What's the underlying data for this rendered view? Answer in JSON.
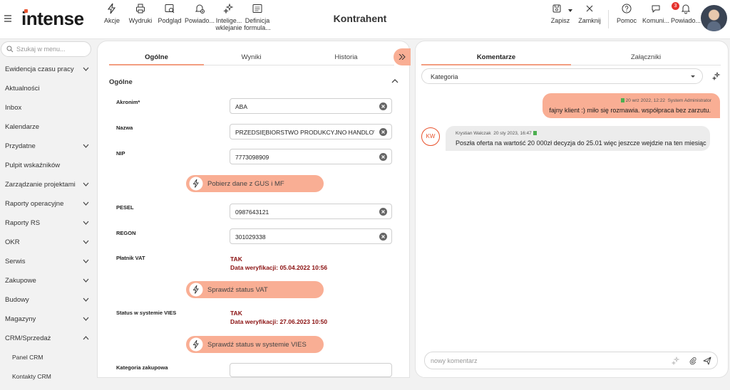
{
  "app": {
    "logo": "intense",
    "page_title": "Kontrahent"
  },
  "colors": {
    "accent": "#e8522d",
    "button": "#f9ae94",
    "vat_text": "#8a1010",
    "badge": "#e5322d"
  },
  "toolbar": {
    "left": [
      {
        "icon": "lightning-icon",
        "label": "Akcje"
      },
      {
        "icon": "printer-icon",
        "label": "Wydruki"
      },
      {
        "icon": "preview-icon",
        "label": "Podgląd"
      },
      {
        "icon": "notification-add-icon",
        "label": "Powiado..."
      },
      {
        "icon": "sparkle-icon",
        "label": "Intelige...",
        "label2": "wklejanie"
      },
      {
        "icon": "formula-icon",
        "label": "Definicja",
        "label2": "formula..."
      }
    ],
    "right": [
      {
        "icon": "save-icon",
        "label": "Zapisz"
      },
      {
        "icon": "close-icon",
        "label": "Zamknij"
      },
      {
        "icon": "help-icon",
        "label": "Pomoc"
      },
      {
        "icon": "chat-icon",
        "label": "Komuni..."
      },
      {
        "icon": "bell-icon",
        "label": "Powiado...",
        "badge": "3"
      }
    ]
  },
  "sidebar": {
    "search_placeholder": "Szukaj w menu...",
    "items": [
      {
        "label": "Ewidencja czasu pracy",
        "chevron": "down"
      },
      {
        "label": "Aktualności",
        "chevron": ""
      },
      {
        "label": "Inbox",
        "chevron": ""
      },
      {
        "label": "Kalendarze",
        "chevron": ""
      },
      {
        "label": "Przydatne",
        "chevron": "down"
      },
      {
        "label": "Pulpit wskaźników",
        "chevron": ""
      },
      {
        "label": "Zarządzanie projektami",
        "chevron": "down"
      },
      {
        "label": "Raporty operacyjne",
        "chevron": "down"
      },
      {
        "label": "Raporty RS",
        "chevron": "down"
      },
      {
        "label": "OKR",
        "chevron": "down"
      },
      {
        "label": "Serwis",
        "chevron": "down"
      },
      {
        "label": "Zakupowe",
        "chevron": "down"
      },
      {
        "label": "Budowy",
        "chevron": "down"
      },
      {
        "label": "Magazyny",
        "chevron": "down"
      },
      {
        "label": "CRM/Sprzedaż",
        "chevron": "up"
      },
      {
        "label": "Panel CRM",
        "chevron": "",
        "sub": true
      },
      {
        "label": "Kontakty CRM",
        "chevron": "",
        "sub": true
      }
    ]
  },
  "form": {
    "tabs": [
      "Ogólne",
      "Wyniki",
      "Historia"
    ],
    "active_tab": 0,
    "section_title": "Ogólne",
    "fields": {
      "akronim": {
        "label": "Akronim*",
        "value": "ABA"
      },
      "nazwa": {
        "label": "Nazwa",
        "value": "PRZEDSIĘBIORSTWO PRODUKCYJNO HANDLOWE"
      },
      "nip": {
        "label": "NIP",
        "value": "7773098909"
      },
      "pesel": {
        "label": "PESEL",
        "value": "0987643121"
      },
      "regon": {
        "label": "REGON",
        "value": "301029338"
      },
      "kategoria_zakupowa": {
        "label": "Kategoria zakupowa",
        "value": ""
      }
    },
    "gus_button": "Pobierz dane z GUS i MF",
    "vat": {
      "label": "Płatnik VAT",
      "status": "TAK",
      "verified": "Data weryfikacji: 05.04.2022 10:56",
      "button": "Sprawdź status VAT"
    },
    "vies": {
      "label": "Status w systemie VIES",
      "status": "TAK",
      "verified": "Data weryfikacji: 27.06.2023 10:50",
      "button": "Sprawdź status w systemie VIES"
    }
  },
  "comments_panel": {
    "tabs": [
      "Komentarze",
      "Załączniki"
    ],
    "active_tab": 0,
    "category_placeholder": "Kategoria",
    "messages": [
      {
        "direction": "outgoing",
        "date": "20 wrz 2022, 12:22",
        "author": "System Administrator",
        "text": "fajny klient :) miło się rozmawia. współpraca bez zarzutu."
      },
      {
        "direction": "incoming",
        "initials": "KW",
        "author": "Krystian Walczak",
        "date": "20 sty 2023, 16:47",
        "text": "Poszła oferta na wartość 20 000zł decyzja do 25.01 więc jeszcze wejdzie na ten miesiąc"
      }
    ],
    "comment_placeholder": "nowy komentarz"
  }
}
